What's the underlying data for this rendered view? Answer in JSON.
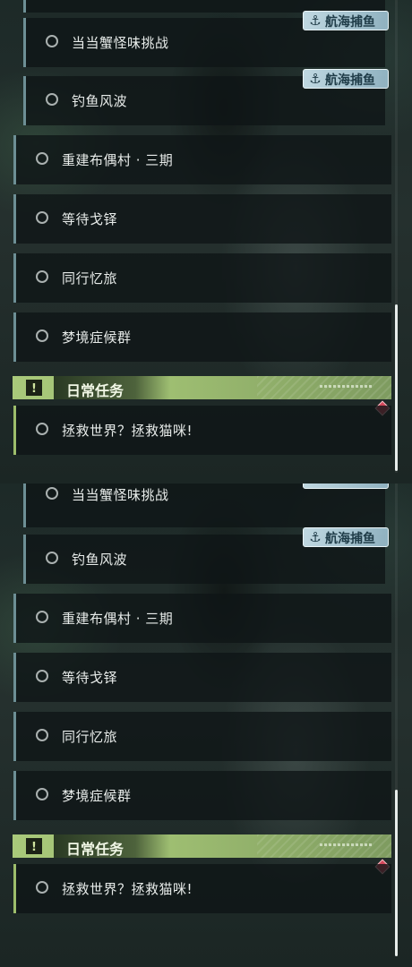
{
  "panels": [
    {
      "quests": [
        {
          "label": "当当蟹怪味挑战",
          "tag": "航海捕鱼",
          "type": "sub"
        },
        {
          "label": "钓鱼风波",
          "tag": "航海捕鱼",
          "type": "sub"
        },
        {
          "label": "重建布偶村 · 三期",
          "type": "main"
        },
        {
          "label": "等待戈铎",
          "type": "main"
        },
        {
          "label": "同行忆旅",
          "type": "main"
        },
        {
          "label": "梦境症候群",
          "type": "main"
        }
      ],
      "section": {
        "title": "日常任务",
        "icon": "!"
      },
      "daily": [
        {
          "label": "拯救世界？拯救猫咪!"
        }
      ]
    },
    {
      "quests": [
        {
          "label": "当当蟹怪味挑战",
          "type": "sub"
        },
        {
          "label": "钓鱼风波",
          "tag": "航海捕鱼",
          "type": "sub"
        },
        {
          "label": "重建布偶村 · 三期",
          "type": "main"
        },
        {
          "label": "等待戈铎",
          "type": "main"
        },
        {
          "label": "同行忆旅",
          "type": "main"
        },
        {
          "label": "梦境症候群",
          "type": "main"
        }
      ],
      "section": {
        "title": "日常任务",
        "icon": "!"
      },
      "daily": [
        {
          "label": "拯救世界？拯救猫咪!"
        }
      ]
    }
  ],
  "icons": {
    "tag_icon": "fishing-hook-icon",
    "section_icon": "exclamation-icon",
    "alert": "diamond-alert-icon"
  },
  "colors": {
    "section_accent": "#a9c97a",
    "quest_border": "#6d8f95",
    "alert": "#d4475a"
  }
}
